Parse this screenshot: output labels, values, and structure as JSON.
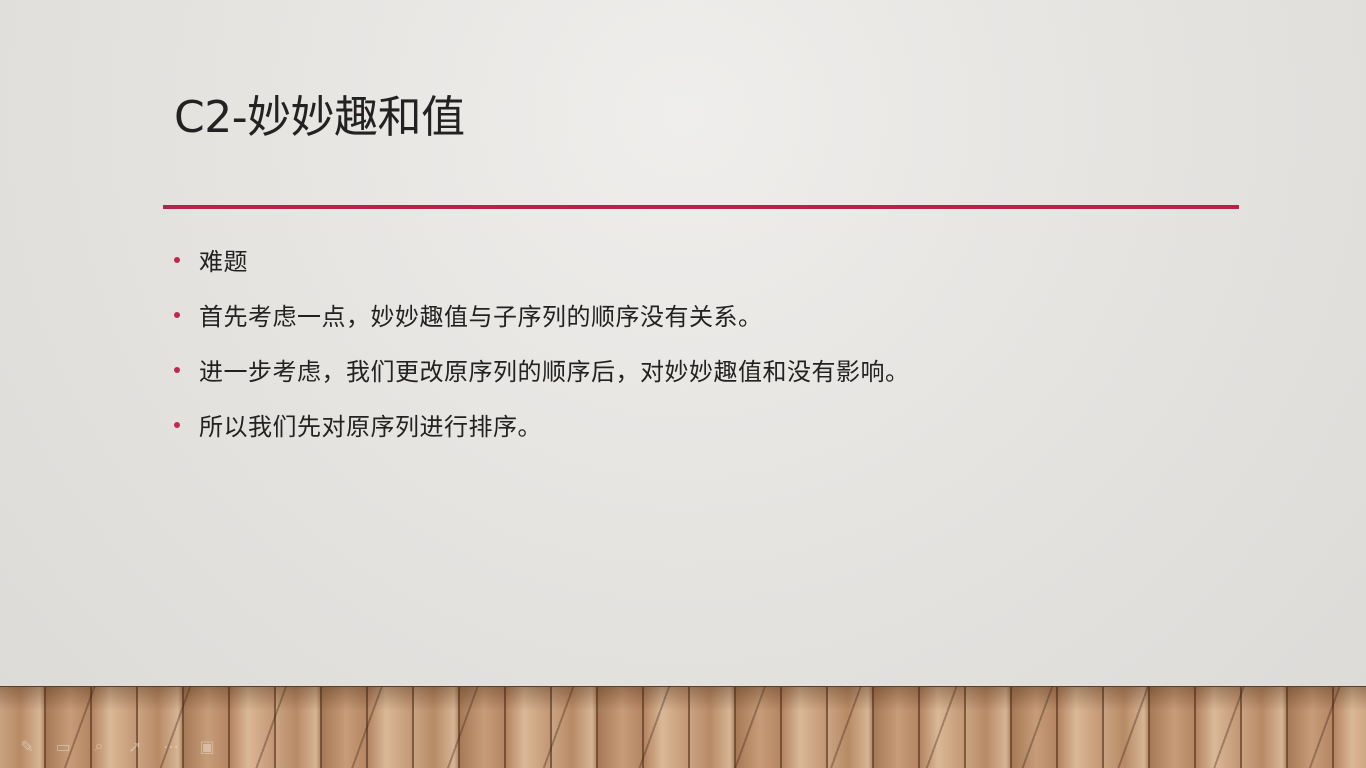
{
  "slide": {
    "title": "C2-妙妙趣和值",
    "accent_color": "#b5224a",
    "bullets": [
      "难题",
      "首先考虑一点，妙妙趣值与子序列的顺序没有关系。",
      "进一步考虑，我们更改原序列的顺序后，对妙妙趣值和没有影响。",
      "所以我们先对原序列进行排序。"
    ]
  },
  "presenter_toolbar": {
    "icons": [
      "pen-icon",
      "slides-icon",
      "search-icon",
      "pointer-icon",
      "more-icon",
      "camera-icon"
    ]
  }
}
